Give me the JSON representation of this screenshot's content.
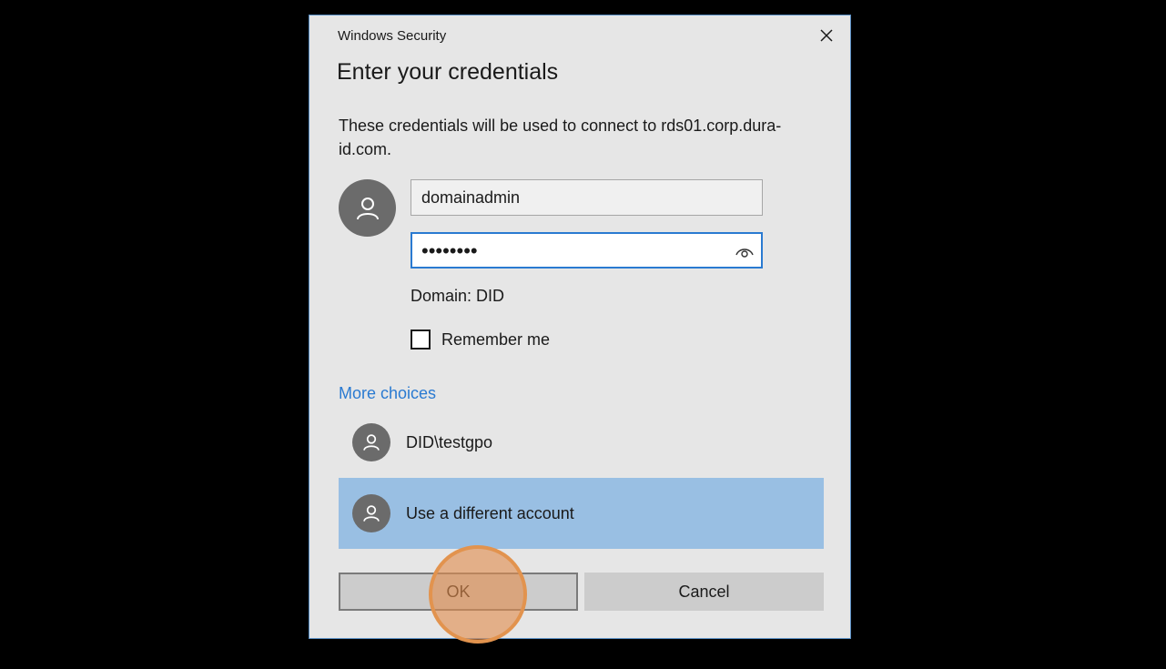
{
  "dialog": {
    "window_title": "Windows Security",
    "heading": "Enter your credentials",
    "description": "These credentials will be used to connect to rds01.corp.dura-id.com.",
    "username_value": "domainadmin",
    "password_masked": "••••••••",
    "domain_text": "Domain: DID",
    "remember_label": "Remember me",
    "remember_checked": false,
    "more_choices_label": "More choices",
    "accounts": [
      {
        "label": "DID\\testgpo",
        "selected": false
      },
      {
        "label": "Use a different account",
        "selected": true
      }
    ],
    "ok_label": "OK",
    "cancel_label": "Cancel"
  },
  "icons": {
    "close": "close-icon",
    "user": "user-icon",
    "reveal_password": "eye-icon"
  },
  "colors": {
    "background": "#000000",
    "dialog_bg": "#e6e6e6",
    "dialog_border": "#5a8fc4",
    "accent": "#2a7ad1",
    "selected_account_bg": "#99bfe3",
    "avatar_bg": "#6b6b6b",
    "button_bg": "#cccccc",
    "click_indicator": "#e2934e"
  }
}
